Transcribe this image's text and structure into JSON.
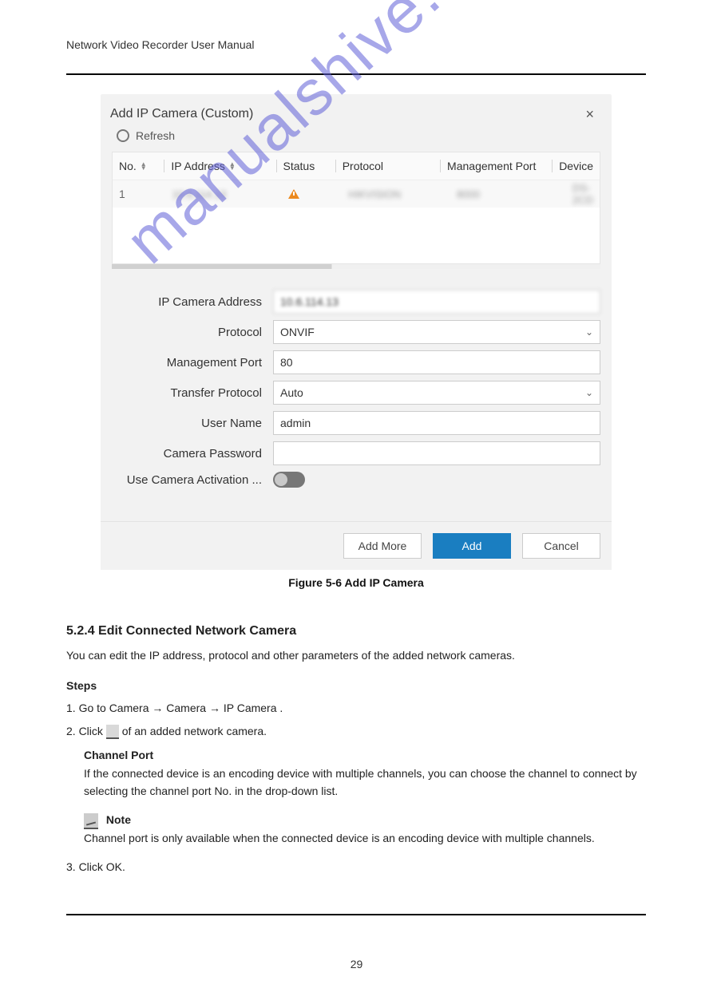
{
  "header": "Network Video Recorder User Manual",
  "dialog": {
    "title": "Add IP Camera (Custom)",
    "close": "×",
    "refresh": "Refresh",
    "columns": {
      "no": "No.",
      "ip": "IP Address",
      "status": "Status",
      "protocol": "Protocol",
      "mport": "Management Port",
      "device": "Device"
    },
    "row": {
      "no": "1",
      "ip": "10.6.114.13",
      "protocol": "HIKVISION",
      "mport": "8000",
      "device": "DS-2CD"
    },
    "form": {
      "labels": {
        "addr": "IP Camera Address",
        "protocol": "Protocol",
        "mport": "Management Port",
        "tproto": "Transfer Protocol",
        "user": "User Name",
        "pwd": "Camera Password",
        "activation": "Use Camera Activation ..."
      },
      "values": {
        "addr": "10.6.114.13",
        "protocol": "ONVIF",
        "mport": "80",
        "tproto": "Auto",
        "user": "admin",
        "pwd": ""
      }
    },
    "buttons": {
      "addmore": "Add More",
      "add": "Add",
      "cancel": "Cancel"
    }
  },
  "watermark": "manualshive.com",
  "figure_caption": "Figure 5-6 Add IP Camera",
  "section": {
    "heading": "5.2.4 Edit Connected Network Camera",
    "intro": "You can edit the IP address, protocol and other parameters of the added network cameras.",
    "steps_title": "Steps",
    "step1": "1. Go to Camera → Camera → IP Camera .",
    "step2_prefix": "2. Click ",
    "step2_suffix": " of an added network camera.",
    "channel_port_label": "Channel Port",
    "channel_port_text": "If the connected device is an encoding device with multiple channels, you can choose the channel to connect by selecting the channel port No. in the drop-down list.",
    "note_label": "Note",
    "note_text": "Channel port is only available when the connected device is an encoding device with multiple channels.",
    "step3": "3. Click OK."
  },
  "page_number": "29"
}
